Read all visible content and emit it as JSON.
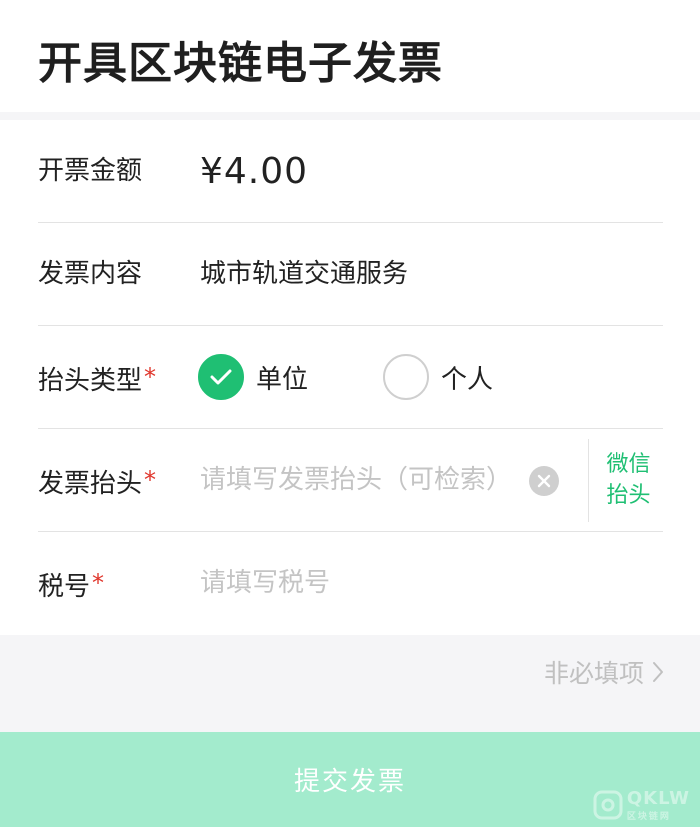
{
  "header": {
    "title": "开具区块链电子发票"
  },
  "form": {
    "amount": {
      "label": "开票金额",
      "value": "¥4.00"
    },
    "content": {
      "label": "发票内容",
      "value": "城市轨道交通服务"
    },
    "title_type": {
      "label": "抬头类型",
      "required_mark": "*",
      "options": [
        {
          "label": "单位",
          "checked": true
        },
        {
          "label": "个人",
          "checked": false
        }
      ]
    },
    "invoice_title": {
      "label": "发票抬头",
      "required_mark": "*",
      "placeholder": "请填写发票抬头（可检索）",
      "wechat_link_line1": "微信",
      "wechat_link_line2": "抬头"
    },
    "tax_number": {
      "label": "税号",
      "required_mark": "*",
      "placeholder": "请填写税号"
    }
  },
  "optional": {
    "label": "非必填项"
  },
  "submit": {
    "label": "提交发票"
  },
  "colors": {
    "accent": "#1fbf73",
    "submit_bg": "#a3ebcd",
    "required": "#e0352b"
  }
}
